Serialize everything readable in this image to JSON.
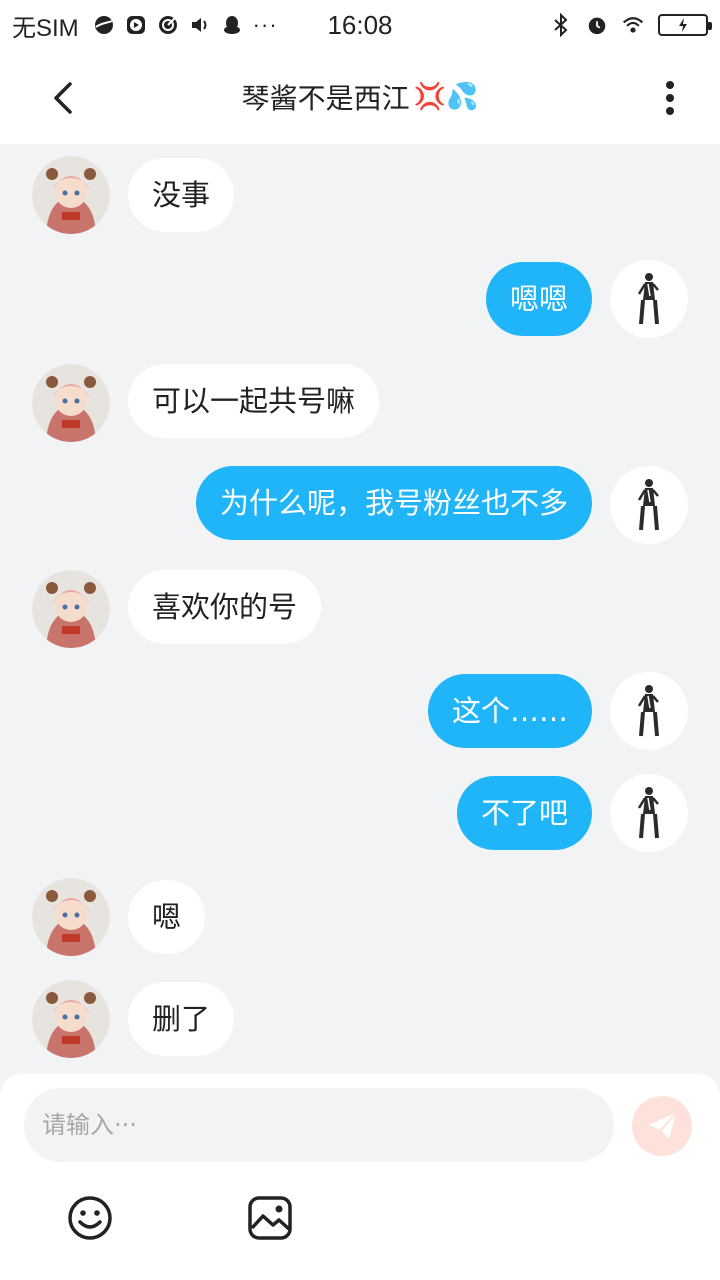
{
  "status_bar": {
    "carrier": "无SIM",
    "time": "16:08",
    "more": "···"
  },
  "header": {
    "title": "琴酱不是西江",
    "title_emojis": "💢💦"
  },
  "messages": [
    {
      "side": "in",
      "text": "没事"
    },
    {
      "side": "out",
      "text": "嗯嗯"
    },
    {
      "side": "in",
      "text": "可以一起共号嘛"
    },
    {
      "side": "out",
      "text": "为什么呢，我号粉丝也不多"
    },
    {
      "side": "in",
      "text": "喜欢你的号"
    },
    {
      "side": "out",
      "text": "这个……"
    },
    {
      "side": "out",
      "text": "不了吧"
    },
    {
      "side": "in",
      "text": "嗯"
    },
    {
      "side": "in",
      "text": "删了"
    }
  ],
  "composer": {
    "placeholder": "请输入···"
  },
  "colors": {
    "outgoing_bubble": "#1fb5f8",
    "incoming_bubble": "#ffffff",
    "background": "#f2f3f5",
    "send_button": "#ffe1dc"
  }
}
